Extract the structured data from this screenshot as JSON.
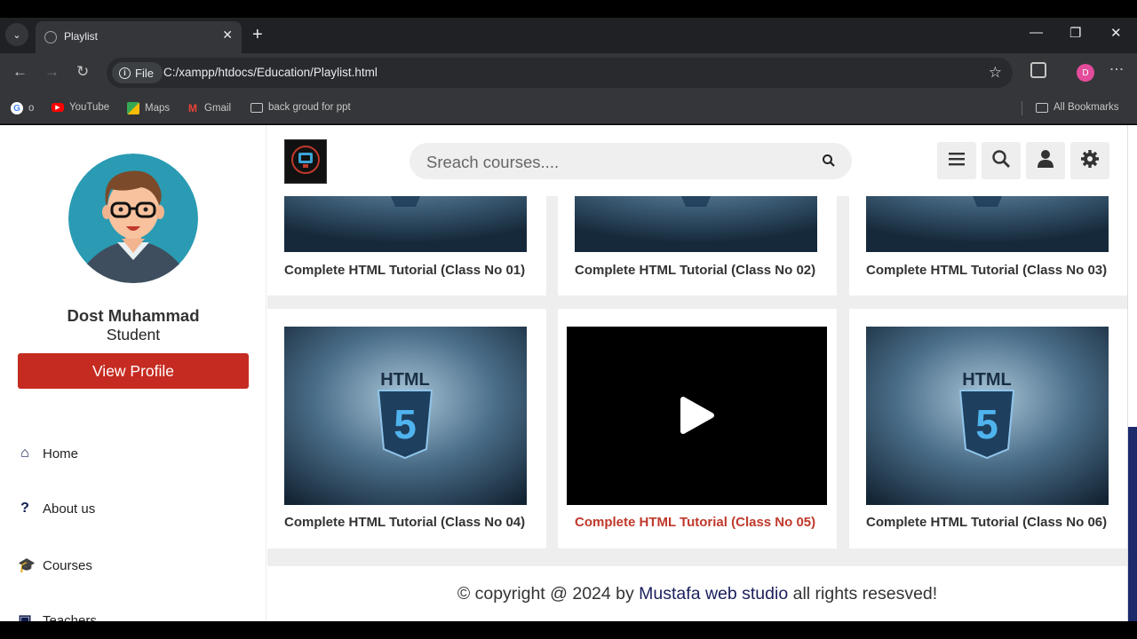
{
  "browser": {
    "tab_title": "Playlist",
    "url_label": "File",
    "url": "C:/xampp/htdocs/Education/Playlist.html",
    "profile_initial": "D",
    "bookmarks": [
      "o",
      "YouTube",
      "Maps",
      "Gmail",
      "back groud for ppt"
    ],
    "all_bookmarks": "All Bookmarks"
  },
  "header": {
    "search_placeholder": "Sreach courses....",
    "icons": [
      "menu-icon",
      "search-icon",
      "user-icon",
      "settings-icon"
    ]
  },
  "sidebar": {
    "user_name": "Dost Muhammad",
    "user_role": "Student",
    "view_profile_label": "View Profile",
    "nav": [
      {
        "label": "Home",
        "icon": "home-icon"
      },
      {
        "label": "About us",
        "icon": "question-icon"
      },
      {
        "label": "Courses",
        "icon": "graduation-cap-icon"
      },
      {
        "label": "Teachers",
        "icon": "chalkboard-icon"
      }
    ]
  },
  "videos": [
    {
      "title": "Complete HTML Tutorial (Class No 01)"
    },
    {
      "title": "Complete HTML Tutorial (Class No 02)"
    },
    {
      "title": "Complete HTML Tutorial (Class No 03)"
    },
    {
      "title": "Complete HTML Tutorial (Class No 04)"
    },
    {
      "title": "Complete HTML Tutorial (Class No 05)"
    },
    {
      "title": "Complete HTML Tutorial (Class No 06)"
    }
  ],
  "footer": {
    "prefix": "© copyright @ 2024 by ",
    "brand": "Mustafa web studio",
    "suffix": " all rights resesved!"
  },
  "colors": {
    "accent_red": "#c62b21",
    "brand_navy": "#1a1f5c",
    "active_title": "#c0392b"
  }
}
